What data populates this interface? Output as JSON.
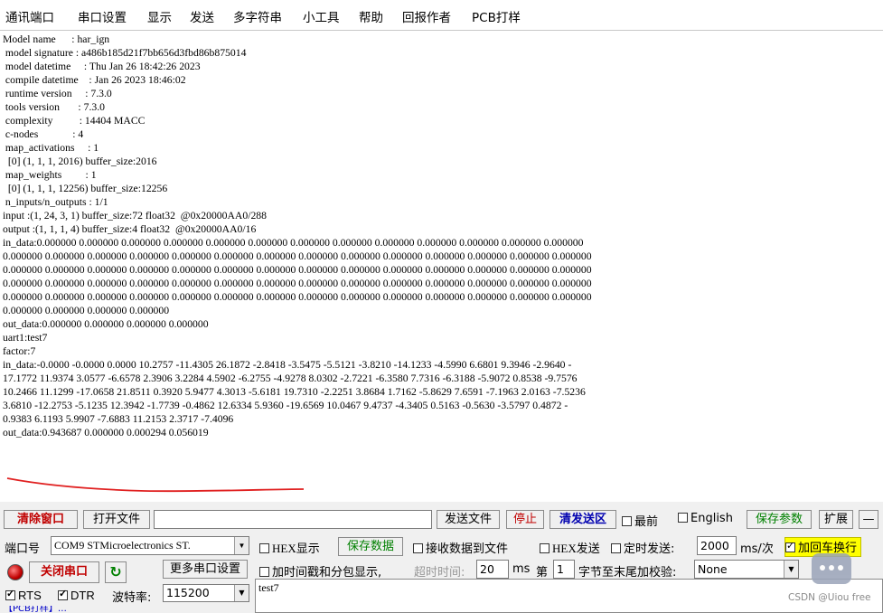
{
  "menu": [
    "通讯端口",
    "串口设置",
    "显示",
    "发送",
    "多字符串",
    "小工具",
    "帮助",
    "回报作者",
    "PCB打样"
  ],
  "terminal": {
    "lines": [
      "Model name      : har_ign",
      " model signature : a486b185d21f7bb656d3fbd86b875014",
      " model datetime     : Thu Jan 26 18:42:26 2023",
      " compile datetime    : Jan 26 2023 18:46:02",
      " runtime version     : 7.3.0",
      " tools version       : 7.3.0",
      " complexity          : 14404 MACC",
      " c-nodes             : 4",
      " map_activations     : 1",
      "  [0] (1, 1, 1, 2016) buffer_size:2016",
      " map_weights         : 1",
      "  [0] (1, 1, 1, 12256) buffer_size:12256",
      " n_inputs/n_outputs : 1/1",
      "input :(1, 24, 3, 1) buffer_size:72 float32  @0x20000AA0/288",
      "output :(1, 1, 1, 4) buffer_size:4 float32  @0x20000AA0/16",
      "in_data:0.000000 0.000000 0.000000 0.000000 0.000000 0.000000 0.000000 0.000000 0.000000 0.000000 0.000000 0.000000 0.000000",
      "0.000000 0.000000 0.000000 0.000000 0.000000 0.000000 0.000000 0.000000 0.000000 0.000000 0.000000 0.000000 0.000000 0.000000",
      "0.000000 0.000000 0.000000 0.000000 0.000000 0.000000 0.000000 0.000000 0.000000 0.000000 0.000000 0.000000 0.000000 0.000000",
      "0.000000 0.000000 0.000000 0.000000 0.000000 0.000000 0.000000 0.000000 0.000000 0.000000 0.000000 0.000000 0.000000 0.000000",
      "0.000000 0.000000 0.000000 0.000000 0.000000 0.000000 0.000000 0.000000 0.000000 0.000000 0.000000 0.000000 0.000000 0.000000",
      "0.000000 0.000000 0.000000 0.000000",
      "out_data:0.000000 0.000000 0.000000 0.000000",
      "uart1:test7",
      "factor:7",
      "in_data:-0.0000 -0.0000 0.0000 10.2757 -11.4305 26.1872 -2.8418 -3.5475 -5.5121 -3.8210 -14.1233 -4.5990 6.6801 9.3946 -2.9640 -",
      "17.1772 11.9374 3.0577 -6.6578 2.3906 3.2284 4.5902 -6.2755 -4.9278 8.0302 -2.7221 -6.3580 7.7316 -6.3188 -5.9072 0.8538 -9.7576",
      "10.2466 11.1299 -17.0658 21.8511 0.3920 5.9477 4.3013 -5.6181 19.7310 -2.2251 3.8684 1.7162 -5.8629 7.6591 -7.1963 2.0163 -7.5236",
      "3.6810 -12.2753 -5.1235 12.3942 -1.7739 -0.4862 12.6334 5.9360 -19.6569 10.0467 9.4737 -4.3405 0.5163 -0.5630 -3.5797 0.4872 -",
      "0.9383 6.1193 5.9907 -7.6883 11.2153 2.3717 -7.4096",
      "out_data:0.943687 0.000000 0.000294 0.056019"
    ]
  },
  "toolbar": {
    "clear_window": "清除窗口",
    "open_file": "打开文件",
    "file_path": "",
    "send_file": "发送文件",
    "stop": "停止",
    "clear_send": "清发送区",
    "topmost": "最前",
    "english": "English",
    "save_params": "保存参数",
    "expand": "扩展",
    "collapse": "—"
  },
  "port": {
    "label": "端口号",
    "value": "COM9 STMicroelectronics ST.",
    "close_port": "关闭串口",
    "more_settings": "更多串口设置",
    "rts": "RTS",
    "dtr": "DTR",
    "baud_label": "波特率:",
    "baud_value": "115200"
  },
  "options": {
    "hex_display": "HEX显示",
    "save_data": "保存数据",
    "recv_to_file": "接收数据到文件",
    "hex_send": "HEX发送",
    "timed_send": "定时发送:",
    "interval": "2000",
    "interval_unit": "ms/次",
    "add_crlf": "加回车换行",
    "timestamp": "加时间戳和分包显示,",
    "timeout_label": "超时时间:",
    "timeout_value": "20",
    "ms": "ms",
    "nth": "第",
    "byte_num": "1",
    "checksum_label": "字节至末尾加校验:",
    "checksum_value": "None"
  },
  "send_text": "test7",
  "bottom_link": "【PCB打样】…",
  "watermark": "CSDN @Uiou free",
  "colors": {
    "accent_red": "#c00000",
    "accent_blue": "#0000c8",
    "accent_green": "#008000",
    "annotation": "#e02020"
  }
}
